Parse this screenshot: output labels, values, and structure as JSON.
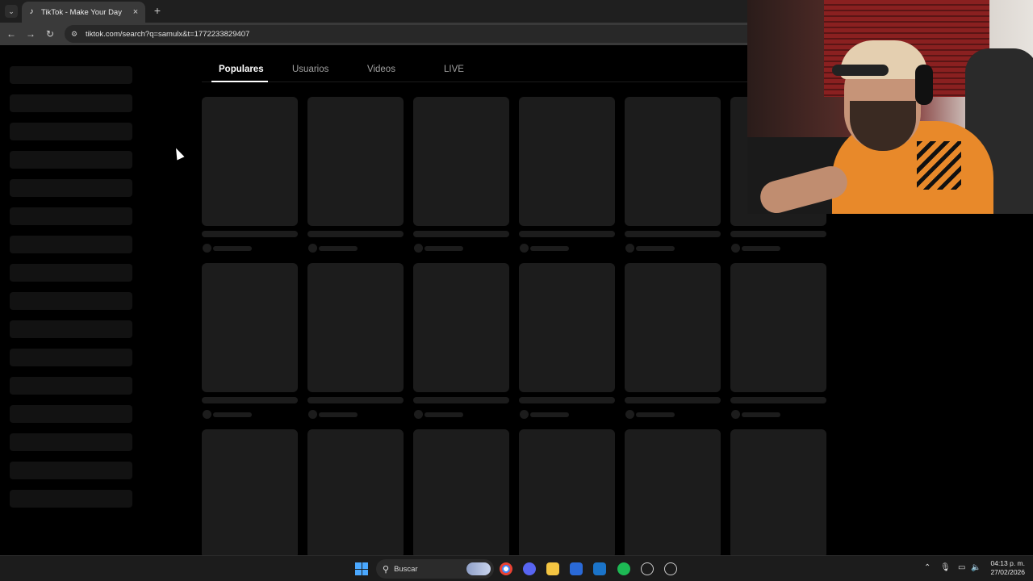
{
  "browser": {
    "tab_title": "TikTok - Make Your Day",
    "tab_favicon": "♪",
    "tab_close": "×",
    "new_tab": "+",
    "url": "tiktok.com/search?q=samulx&t=1772233829407",
    "back_icon": "←",
    "forward_icon": "→",
    "reload_icon": "↻",
    "tab_menu_icon": "⌄",
    "site_info_icon": "⚙"
  },
  "search_tabs": [
    {
      "label": "Populares",
      "active": true
    },
    {
      "label": "Usuarios",
      "active": false
    },
    {
      "label": "Videos",
      "active": false
    },
    {
      "label": "LIVE",
      "active": false
    }
  ],
  "taskbar": {
    "search_placeholder": "Buscar",
    "search_icon": "⚲",
    "time": "04:13 p. m.",
    "date": "27/02/2026",
    "tray_up": "⌃",
    "tray_mic": "🎙",
    "tray_net": "▭",
    "tray_vol": "🔈"
  },
  "colors": {
    "windows_blue": "#4aa8ff",
    "chrome": "#1f1f1f",
    "skeleton": "#1c1c1c",
    "sidebar_skeleton": "#121212"
  }
}
